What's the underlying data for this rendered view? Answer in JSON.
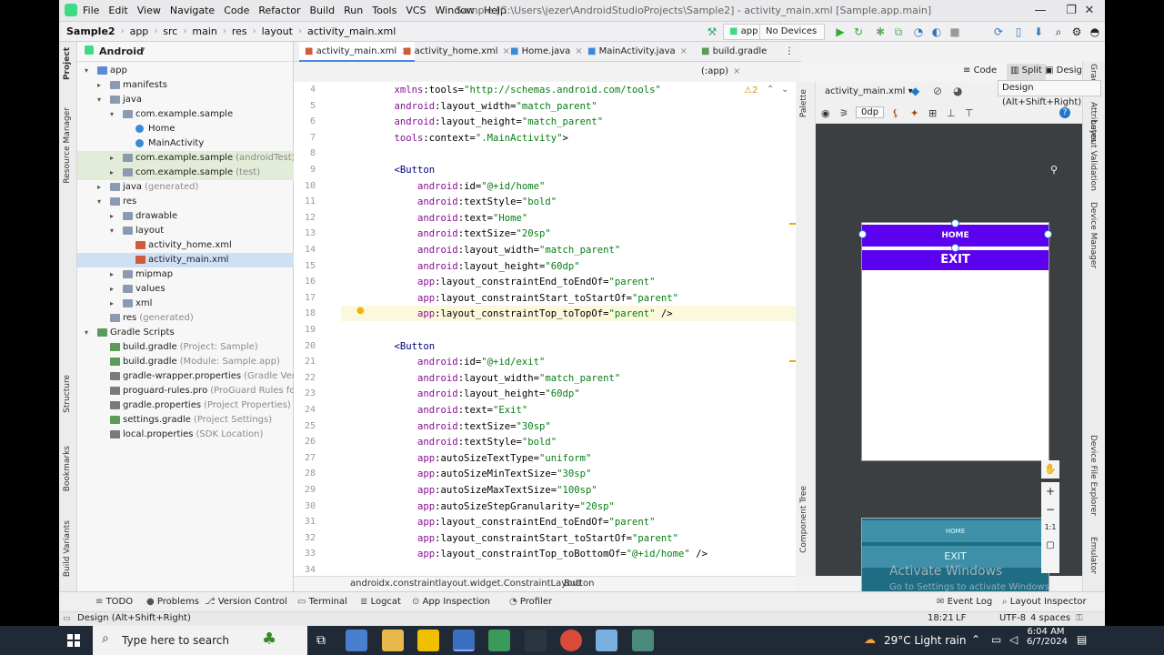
{
  "window": {
    "menus": [
      "File",
      "Edit",
      "View",
      "Navigate",
      "Code",
      "Refactor",
      "Build",
      "Run",
      "Tools",
      "VCS",
      "Window",
      "Help"
    ],
    "title": "Sample [C:\\Users\\jezer\\AndroidStudioProjects\\Sample2] - activity_main.xml [Sample.app.main]"
  },
  "breadcrumb": [
    "Sample2",
    "app",
    "src",
    "main",
    "res",
    "layout",
    "activity_main.xml"
  ],
  "toolbar": {
    "run_config": "app",
    "device": "No Devices"
  },
  "project_panel": {
    "view": "Android",
    "tree": [
      {
        "label": "app",
        "sub": ""
      },
      {
        "label": "manifests",
        "sub": ""
      },
      {
        "label": "java",
        "sub": ""
      },
      {
        "label": "com.example.sample",
        "sub": ""
      },
      {
        "label": "Home",
        "sub": ""
      },
      {
        "label": "MainActivity",
        "sub": ""
      },
      {
        "label": "com.example.sample",
        "sub": "(androidTest)"
      },
      {
        "label": "com.example.sample",
        "sub": "(test)"
      },
      {
        "label": "java",
        "sub": "(generated)"
      },
      {
        "label": "res",
        "sub": ""
      },
      {
        "label": "drawable",
        "sub": ""
      },
      {
        "label": "layout",
        "sub": ""
      },
      {
        "label": "activity_home.xml",
        "sub": ""
      },
      {
        "label": "activity_main.xml",
        "sub": ""
      },
      {
        "label": "mipmap",
        "sub": ""
      },
      {
        "label": "values",
        "sub": ""
      },
      {
        "label": "xml",
        "sub": ""
      },
      {
        "label": "res",
        "sub": "(generated)"
      },
      {
        "label": "Gradle Scripts",
        "sub": ""
      },
      {
        "label": "build.gradle",
        "sub": "(Project: Sample)"
      },
      {
        "label": "build.gradle",
        "sub": "(Module: Sample.app)"
      },
      {
        "label": "gradle-wrapper.properties",
        "sub": "(Gradle Version)"
      },
      {
        "label": "proguard-rules.pro",
        "sub": "(ProGuard Rules for Samp"
      },
      {
        "label": "gradle.properties",
        "sub": "(Project Properties)"
      },
      {
        "label": "settings.gradle",
        "sub": "(Project Settings)"
      },
      {
        "label": "local.properties",
        "sub": "(SDK Location)"
      }
    ]
  },
  "left_stripe": [
    "Project",
    "Resource Manager",
    "Structure",
    "Bookmarks",
    "Build Variants"
  ],
  "right_stripe": [
    "Gradle",
    "Attributes",
    "Layout Validation",
    "Device Manager",
    "Device File Explorer",
    "Emulator"
  ],
  "tabs": [
    "activity_main.xml",
    "activity_home.xml",
    "Home.java",
    "MainActivity.java",
    "build.gradle (:app)"
  ],
  "view_modes": [
    "Code",
    "Split",
    "Design"
  ],
  "editor": {
    "warnings": "2",
    "lines": [
      {
        "n": "4",
        "t": "    xmlns:tools=\"http://schemas.android.com/tools\""
      },
      {
        "n": "5",
        "t": "    android:layout_width=\"match_parent\""
      },
      {
        "n": "6",
        "t": "    android:layout_height=\"match_parent\""
      },
      {
        "n": "7",
        "t": "    tools:context=\".MainActivity\">"
      },
      {
        "n": "8",
        "t": ""
      },
      {
        "n": "9",
        "t": "    <Button"
      },
      {
        "n": "10",
        "t": "        android:id=\"@+id/home\""
      },
      {
        "n": "11",
        "t": "        android:textStyle=\"bold\""
      },
      {
        "n": "12",
        "t": "        android:text=\"Home\""
      },
      {
        "n": "13",
        "t": "        android:textSize=\"20sp\""
      },
      {
        "n": "14",
        "t": "        android:layout_width=\"match_parent\""
      },
      {
        "n": "15",
        "t": "        android:layout_height=\"60dp\""
      },
      {
        "n": "16",
        "t": "        app:layout_constraintEnd_toEndOf=\"parent\""
      },
      {
        "n": "17",
        "t": "        app:layout_constraintStart_toStartOf=\"parent\""
      },
      {
        "n": "18",
        "t": "        app:layout_constraintTop_toTopOf=\"parent\" />"
      },
      {
        "n": "19",
        "t": ""
      },
      {
        "n": "20",
        "t": "    <Button"
      },
      {
        "n": "21",
        "t": "        android:id=\"@+id/exit\""
      },
      {
        "n": "22",
        "t": "        android:layout_width=\"match_parent\""
      },
      {
        "n": "23",
        "t": "        android:layout_height=\"60dp\""
      },
      {
        "n": "24",
        "t": "        android:text=\"Exit\""
      },
      {
        "n": "25",
        "t": "        android:textSize=\"30sp\""
      },
      {
        "n": "26",
        "t": "        android:textStyle=\"bold\""
      },
      {
        "n": "27",
        "t": "        app:autoSizeTextType=\"uniform\""
      },
      {
        "n": "28",
        "t": "        app:autoSizeMinTextSize=\"30sp\""
      },
      {
        "n": "29",
        "t": "        app:autoSizeMaxTextSize=\"100sp\""
      },
      {
        "n": "30",
        "t": "        app:autoSizeStepGranularity=\"20sp\""
      },
      {
        "n": "31",
        "t": "        app:layout_constraintEnd_toEndOf=\"parent\""
      },
      {
        "n": "32",
        "t": "        app:layout_constraintStart_toStartOf=\"parent\""
      },
      {
        "n": "33",
        "t": "        app:layout_constraintTop_toBottomOf=\"@+id/home\" />"
      },
      {
        "n": "34",
        "t": ""
      }
    ],
    "breadcrumb": [
      "androidx.constraintlayout.widget.ConstraintLayout",
      "Button"
    ]
  },
  "design": {
    "file": "activity_main.xml",
    "dp": "0dp",
    "tooltip": "Design (Alt+Shift+Right)",
    "home_button": "HOME",
    "exit_button": "EXIT",
    "side_labels": [
      "Palette",
      "Component Tree"
    ],
    "zoom": [
      "+",
      "−",
      "1:1"
    ]
  },
  "bottom_tools": [
    "TODO",
    "Problems",
    "Version Control",
    "Terminal",
    "Logcat",
    "App Inspection",
    "Profiler",
    "Event Log",
    "Layout Inspector"
  ],
  "status": {
    "left": "Design (Alt+Shift+Right)",
    "position": "18:21",
    "line_sep": "LF",
    "encoding": "UTF-8",
    "indent": "4 spaces"
  },
  "watermark": {
    "title": "Activate Windows",
    "sub": "Go to Settings to activate Windows."
  },
  "taskbar": {
    "search_placeholder": "Type here to search",
    "weather": "29°C  Light rain",
    "time": "6:04 AM",
    "date": "6/7/2024"
  }
}
